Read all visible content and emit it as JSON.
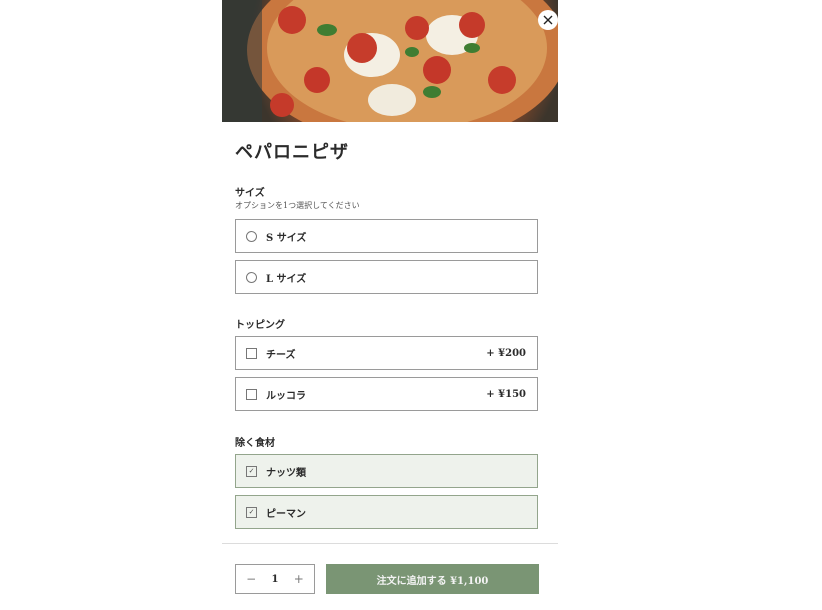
{
  "item": {
    "title": "ペパロニピザ"
  },
  "size": {
    "title": "サイズ",
    "subtitle": "オプションを1つ選択してください",
    "options": [
      {
        "label": "S サイズ"
      },
      {
        "label": "L サイズ"
      }
    ]
  },
  "toppings": {
    "title": "トッピング",
    "options": [
      {
        "label": "チーズ",
        "price": "+ ¥200"
      },
      {
        "label": "ルッコラ",
        "price": "+ ¥150"
      }
    ]
  },
  "exclude": {
    "title": "除く食材",
    "options": [
      {
        "label": "ナッツ類",
        "checked": true
      },
      {
        "label": "ピーマン",
        "checked": true
      }
    ]
  },
  "footer": {
    "quantity": "1",
    "add_label": "注文に追加する ¥1,100"
  },
  "colors": {
    "accent": "#7a9574",
    "selected_bg": "#eef2ec"
  },
  "icons": {
    "close": "close-icon",
    "minus": "minus-icon",
    "plus": "plus-icon"
  }
}
